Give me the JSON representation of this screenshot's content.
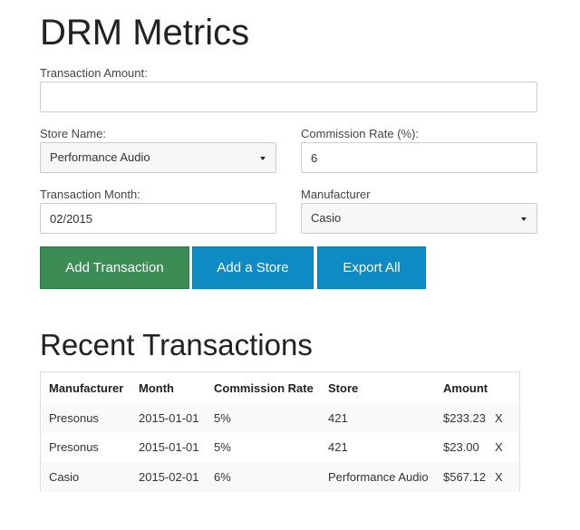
{
  "page": {
    "title": "DRM Metrics"
  },
  "form": {
    "amount": {
      "label": "Transaction Amount:",
      "value": ""
    },
    "store": {
      "label": "Store Name:",
      "value": "Performance Audio"
    },
    "commission": {
      "label": "Commission Rate (%):",
      "value": "6"
    },
    "month": {
      "label": "Transaction Month:",
      "value": "02/2015"
    },
    "manufacturer": {
      "label": "Manufacturer",
      "value": "Casio"
    }
  },
  "buttons": {
    "add_transaction": "Add Transaction",
    "add_store": "Add a Store",
    "export_all": "Export All"
  },
  "recent": {
    "title": "Recent Transactions",
    "headers": [
      "Manufacturer",
      "Month",
      "Commission Rate",
      "Store",
      "Amount"
    ],
    "rows": [
      {
        "manufacturer": "Presonus",
        "month": "2015-01-01",
        "rate": "5%",
        "store": "421",
        "amount": "$233.23",
        "delete": "X"
      },
      {
        "manufacturer": "Presonus",
        "month": "2015-01-01",
        "rate": "5%",
        "store": "421",
        "amount": "$23.00",
        "delete": "X"
      },
      {
        "manufacturer": "Casio",
        "month": "2015-02-01",
        "rate": "6%",
        "store": "Performance Audio",
        "amount": "$567.12",
        "delete": "X"
      }
    ]
  },
  "colors": {
    "green_button": "#3b8c55",
    "blue_button": "#0f8bc4"
  }
}
